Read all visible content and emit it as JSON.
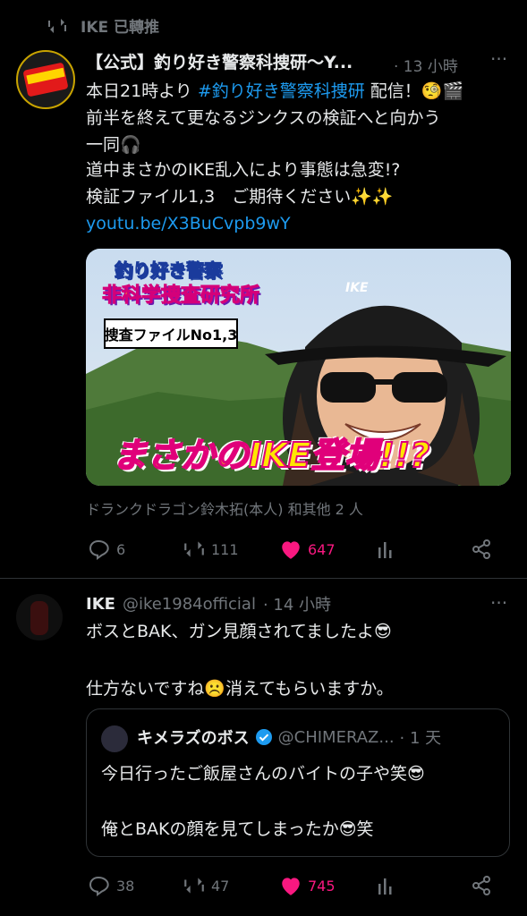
{
  "repost_header": {
    "label": "IKE 已轉推"
  },
  "tweet1": {
    "name": "【公式】釣り好き警察科捜研〜Y...",
    "time": "· 13 小時",
    "more": "···",
    "line1_pre": "本日21時より ",
    "line1_tag": "#釣り好き警察科捜研",
    "line1_post": " 配信！🧐🎬",
    "line2": "前半を終えて更なるジンクスの検証へと向かう",
    "line3": "一同🎧",
    "line4": "道中まさかのIKE乱入により事態は急変!?",
    "line5": "検証ファイル1,3　ご期待ください✨✨",
    "link": "youtu.be/X3BuCvpb9wY",
    "thumb": {
      "logo_line1": "釣り好き警察",
      "logo_line2": "非科学捜査研究所",
      "file_label": "捜査ファイルNo1,3",
      "banner": "まさかのIKE登場!!?",
      "cap_text": "IKE"
    },
    "likers": "ドランクドラゴン鈴木拓(本人) 和其他 2 人",
    "replies": "6",
    "reposts": "111",
    "likes": "647"
  },
  "tweet2": {
    "name": "IKE",
    "handle": "@ike1984official",
    "time": "· 14 小時",
    "more": "···",
    "line1": "ボスとBAK、ガン見顔されてましたよ😎",
    "line2": "仕方ないですね☹️消えてもらいますか。",
    "quote": {
      "name": "キメラズのボス",
      "handle": "@CHIMERAZ...",
      "time": "· 1 天",
      "line1": "今日行ったご飯屋さんのバイトの子や笑😎",
      "line2": "俺とBAKの顔を見てしまったか😎笑"
    },
    "replies": "38",
    "reposts": "47",
    "likes": "745"
  },
  "colors": {
    "accent": "#1d9bf0",
    "like": "#f91880",
    "muted": "#71767b",
    "divider": "#2f3336"
  }
}
